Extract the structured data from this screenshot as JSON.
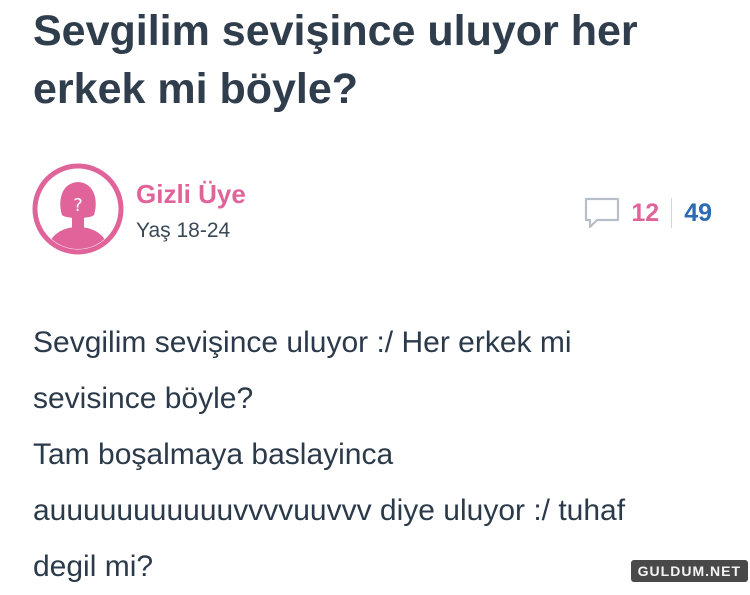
{
  "question": {
    "title_line1": "Sevgilim sevişince uluyor her",
    "title_line2": "erkek mi böyle?"
  },
  "author": {
    "name": "Gizli Üye",
    "age": "Yaş 18-24",
    "avatar_icon": "anonymous-female-avatar-icon"
  },
  "stats": {
    "comment_icon": "speech-bubble-icon",
    "comment_count": "12",
    "vote_count": "49"
  },
  "body": {
    "lines": [
      "Sevgilim sevişince uluyor :/ Her erkek mi",
      "sevisince böyle?",
      "Tam boşalmaya baslayinca",
      "auuuuuuuuuuuvvvvuuvvv diye uluyor :/ tuhaf",
      "degil mi?"
    ]
  },
  "watermark": "GULDUM.NET",
  "colors": {
    "title": "#2f3d4c",
    "pink": "#e0649a",
    "blue": "#2d6ab5",
    "text": "#2b3a4a"
  }
}
